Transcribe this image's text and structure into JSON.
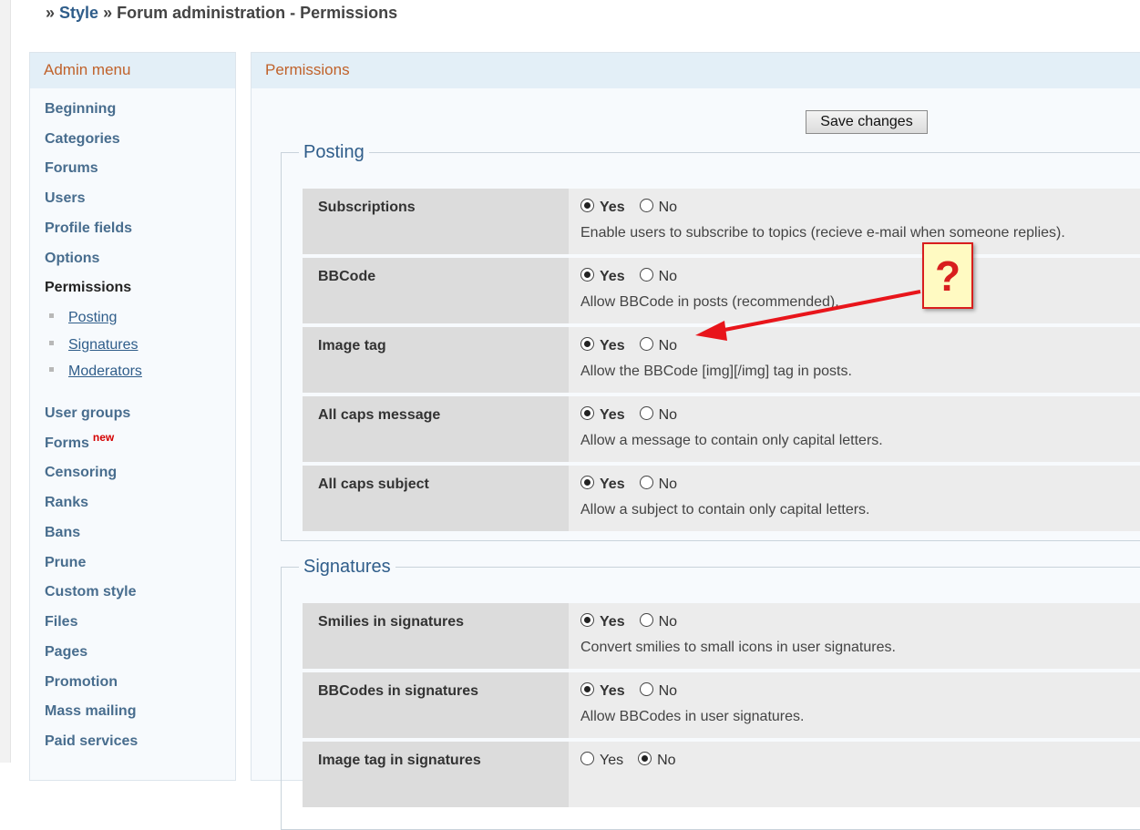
{
  "breadcrumb": {
    "sep": "»",
    "style_link": "Style",
    "current": "Forum administration - Permissions"
  },
  "sidebar": {
    "title": "Admin menu",
    "items": [
      "Beginning",
      "Categories",
      "Forums",
      "Users",
      "Profile fields",
      "Options",
      "Permissions"
    ],
    "sub_items": [
      "Posting",
      "Signatures",
      "Moderators"
    ],
    "items2": [
      "User groups",
      "Forms",
      "Censoring",
      "Ranks",
      "Bans",
      "Prune",
      "Custom style",
      "Files",
      "Pages",
      "Promotion",
      "Mass mailing",
      "Paid services"
    ],
    "new_badge": "new"
  },
  "main": {
    "title": "Permissions",
    "save_label": "Save changes",
    "yes_label": "Yes",
    "no_label": "No"
  },
  "posting": {
    "legend": "Posting",
    "rows": [
      {
        "label": "Subscriptions",
        "selected": "Yes",
        "desc": "Enable users to subscribe to topics (recieve e-mail when someone replies)."
      },
      {
        "label": "BBCode",
        "selected": "Yes",
        "desc": "Allow BBCode in posts (recommended)."
      },
      {
        "label": "Image tag",
        "selected": "Yes",
        "desc": "Allow the BBCode [img][/img] tag in posts."
      },
      {
        "label": "All caps message",
        "selected": "Yes",
        "desc": "Allow a message to contain only capital letters."
      },
      {
        "label": "All caps subject",
        "selected": "Yes",
        "desc": "Allow a subject to contain only capital letters."
      }
    ]
  },
  "signatures": {
    "legend": "Signatures",
    "rows": [
      {
        "label": "Smilies in signatures",
        "selected": "Yes",
        "desc": "Convert smilies to small icons in user signatures."
      },
      {
        "label": "BBCodes in signatures",
        "selected": "Yes",
        "desc": "Allow BBCodes in user signatures."
      },
      {
        "label": "Image tag in signatures",
        "selected": "No",
        "desc": ""
      }
    ]
  },
  "annotation": {
    "mark": "?"
  },
  "colors": {
    "accent": "#c0622b",
    "link": "#2f5d8a",
    "annotation": "#d81e1e"
  }
}
